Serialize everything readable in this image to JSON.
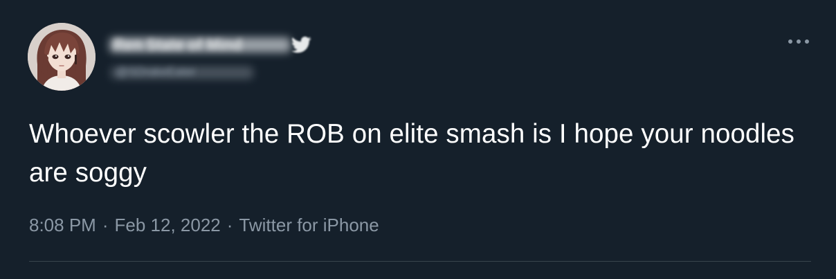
{
  "tweet": {
    "author": {
      "display_name": "Ren State of Mind",
      "handle": "@SDrakeEater",
      "verified_icon": "twitter-bird-icon",
      "avatar_icon": "anime-avatar"
    },
    "more_icon": "more-horizontal-icon",
    "text": "Whoever scowler the ROB on elite smash is I hope your noodles are soggy",
    "time": "8:08 PM",
    "date": "Feb 12, 2022",
    "source": "Twitter for iPhone",
    "separator": "·"
  },
  "colors": {
    "background": "#15202b",
    "text_primary": "#ffffff",
    "text_secondary": "#8b98a5",
    "divider": "#38444d",
    "brand_blue": "#1d9bf0"
  }
}
